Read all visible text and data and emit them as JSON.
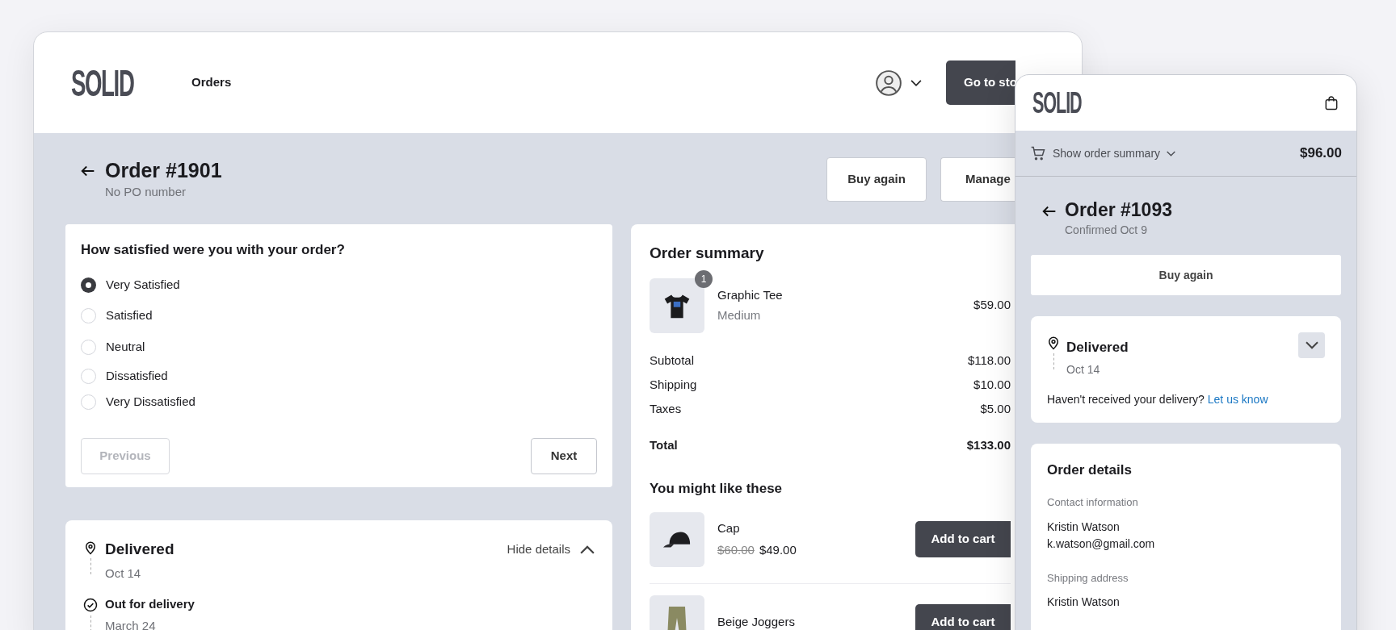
{
  "desktop": {
    "logo": "SOLID",
    "nav": "Orders",
    "store_button": "Go to sto",
    "order": {
      "title": "Order #1901",
      "subtitle": "No PO number"
    },
    "actions": [
      "Buy again",
      "Manage"
    ],
    "survey": {
      "question": "How satisfied were you with your order?",
      "options": [
        {
          "label": "Very Satisfied",
          "selected": true
        },
        {
          "label": "Satisfied",
          "selected": false
        },
        {
          "label": "Neutral",
          "selected": false
        },
        {
          "label": "Dissatisfied",
          "selected": false
        },
        {
          "label": "Very Dissatisfied",
          "selected": false
        }
      ],
      "previous": {
        "label": "Previous",
        "disabled": true
      },
      "next": {
        "label": "Next",
        "disabled": false
      }
    },
    "delivery": {
      "toggle": "Hide details",
      "expanded": true,
      "events": [
        {
          "kind": "delivered",
          "title": "Delivered",
          "date": "Oct 14"
        },
        {
          "kind": "step",
          "title": "Out for delivery",
          "date": "March 24"
        }
      ]
    },
    "summary": {
      "title": "Order summary",
      "items": [
        {
          "kind": "shirt",
          "name": "Graphic Tee",
          "variant": "Medium",
          "price": "$59.00",
          "quantity": "1"
        }
      ],
      "totals": [
        {
          "kind": "line",
          "label": "Subtotal",
          "value": "$118.00"
        },
        {
          "kind": "line",
          "label": "Shipping",
          "value": "$10.00"
        },
        {
          "kind": "line",
          "label": "Taxes",
          "value": "$5.00"
        },
        {
          "kind": "total",
          "label": "Total",
          "value": "$133.00"
        }
      ],
      "recommend_title": "You might like these",
      "recommendations": [
        {
          "kind": "cap",
          "name": "Cap",
          "original_price": "$60.00",
          "price": "$49.00",
          "button": "Add to cart"
        },
        {
          "kind": "pants",
          "name": "Beige Joggers",
          "button": "Add to cart"
        }
      ]
    }
  },
  "mobile": {
    "logo": "SOLID",
    "summary_toggle": "Show order summary",
    "summary_total": "$96.00",
    "order": {
      "title": "Order #1093",
      "subtitle": "Confirmed Oct 9"
    },
    "buy_again": "Buy again",
    "delivery": {
      "title": "Delivered",
      "date": "Oct 14",
      "expanded": false,
      "help": "Haven't received your delivery?",
      "link": "Let us know"
    },
    "details": {
      "title": "Order details",
      "sections": [
        {
          "label": "Contact information",
          "lines": [
            "Kristin Watson",
            "k.watson@gmail.com"
          ]
        },
        {
          "label": "Shipping address",
          "lines": [
            "Kristin Watson"
          ]
        }
      ]
    }
  }
}
